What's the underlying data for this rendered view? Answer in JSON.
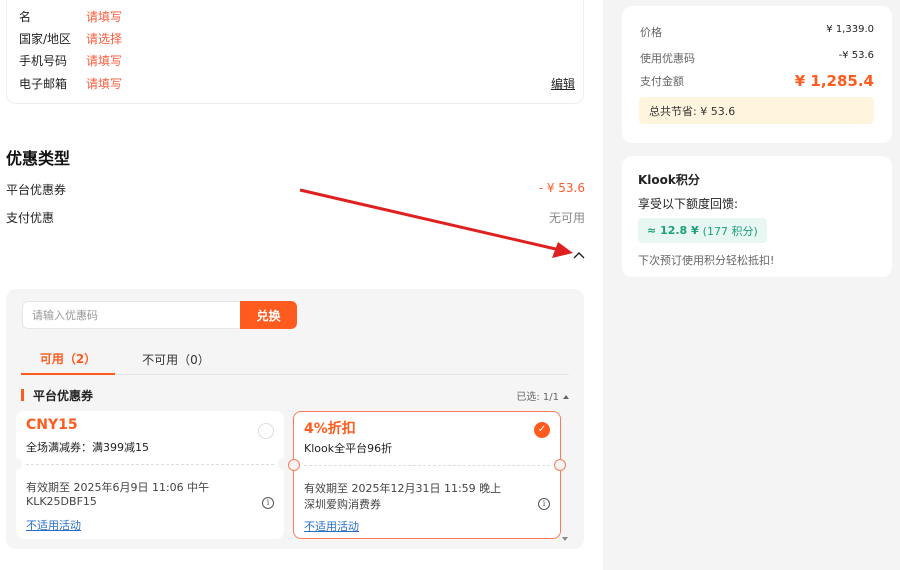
{
  "contact": {
    "rows": [
      {
        "label": "名",
        "value": "请填写"
      },
      {
        "label": "国家/地区",
        "value": "请选择"
      },
      {
        "label": "手机号码",
        "value": "请填写"
      },
      {
        "label": "电子邮箱",
        "value": "请填写"
      }
    ],
    "edit_label": "编辑"
  },
  "promo": {
    "title": "优惠类型",
    "platform_label": "平台优惠券",
    "platform_value": "- ¥ 53.6",
    "payment_label": "支付优惠",
    "payment_value": "无可用"
  },
  "coupon_panel": {
    "input_placeholder": "请输入优惠码",
    "redeem_label": "兑换",
    "tabs": {
      "available": "可用（2）",
      "unavailable": "不可用（0）"
    },
    "group_title": "平台优惠券",
    "group_selected": "已选: 1/1",
    "coupons": [
      {
        "title": "CNY15",
        "desc": "全场满减券：满399减15",
        "expiry": "有效期至 2025年6月9日 11:06 中午",
        "code": "KLK25DBF15",
        "link": "不适用活动",
        "selected": false
      },
      {
        "title": "4%折扣",
        "desc": "Klook全平台96折",
        "expiry": "有效期至 2025年12月31日 11:59 晚上",
        "code": "深圳爱购消费券",
        "link": "不适用活动",
        "selected": true
      }
    ]
  },
  "price": {
    "price_label": "价格",
    "price_value": "¥ 1,339.0",
    "discount_label": "使用优惠码",
    "discount_value": "-¥ 53.6",
    "total_label": "支付金额",
    "total_value": "¥ 1,285.4",
    "savings": "总共节省: ¥ 53.6"
  },
  "klook": {
    "title": "Klook积分",
    "subtitle": "享受以下额度回馈:",
    "badge_value": "≈ 12.8 ¥",
    "badge_points": "(177 积分)",
    "footer": "下次预订使用积分轻松抵扣!"
  },
  "colors": {
    "accent": "#ff5b1f",
    "link": "#2a6fc9",
    "green": "#1aa07a",
    "arrow": "#e02020"
  }
}
